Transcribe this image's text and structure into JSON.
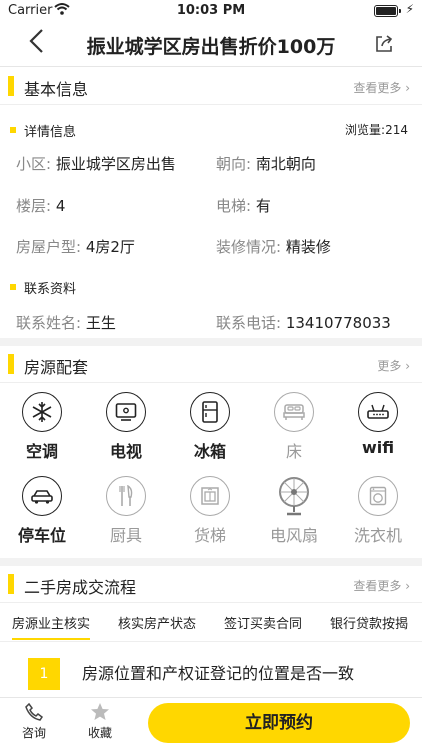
{
  "status": {
    "carrier": "Carrier",
    "time": "10:03 PM"
  },
  "nav": {
    "title": "振业城学区房出售折价100万"
  },
  "basic": {
    "title": "基本信息",
    "more": "查看更多",
    "detail_title": "详情信息",
    "views": "浏览量:214",
    "rows": [
      {
        "l1": "小区:",
        "v1": "振业城学区房出售",
        "l2": "朝向:",
        "v2": "南北朝向"
      },
      {
        "l1": "楼层:",
        "v1": "4",
        "l2": "电梯:",
        "v2": "有"
      },
      {
        "l1": "房屋户型:",
        "v1": "4房2厅",
        "l2": "装修情况:",
        "v2": "精装修"
      }
    ],
    "contact_title": "联系资料",
    "contact": {
      "l1": "联系姓名:",
      "v1": "王生",
      "l2": "联系电话:",
      "v2": "13410778033"
    }
  },
  "amenities": {
    "title": "房源配套",
    "more": "更多",
    "items": [
      {
        "name": "空调",
        "icon": "snowflake-icon",
        "on": true
      },
      {
        "name": "电视",
        "icon": "tv-icon",
        "on": true
      },
      {
        "name": "冰箱",
        "icon": "fridge-icon",
        "on": true
      },
      {
        "name": "床",
        "icon": "bed-icon",
        "on": false
      },
      {
        "name": "wifi",
        "icon": "router-icon",
        "on": true
      },
      {
        "name": "停车位",
        "icon": "car-icon",
        "on": true
      },
      {
        "name": "厨具",
        "icon": "kitchenware-icon",
        "on": false
      },
      {
        "name": "货梯",
        "icon": "elevator-icon",
        "on": false
      },
      {
        "name": "电风扇",
        "icon": "fan-icon",
        "on": false
      },
      {
        "name": "洗衣机",
        "icon": "washer-icon",
        "on": false
      }
    ]
  },
  "process": {
    "title": "二手房成交流程",
    "more": "查看更多",
    "tabs": [
      "房源业主核实",
      "核实房产状态",
      "签订买卖合同",
      "银行贷款按揭"
    ],
    "step_num": "1",
    "step_text": "房源位置和产权证登记的位置是否一致"
  },
  "bottom": {
    "consult": "咨询",
    "favorite": "收藏",
    "book": "立即预约"
  },
  "colors": {
    "accent": "#FFD700"
  }
}
